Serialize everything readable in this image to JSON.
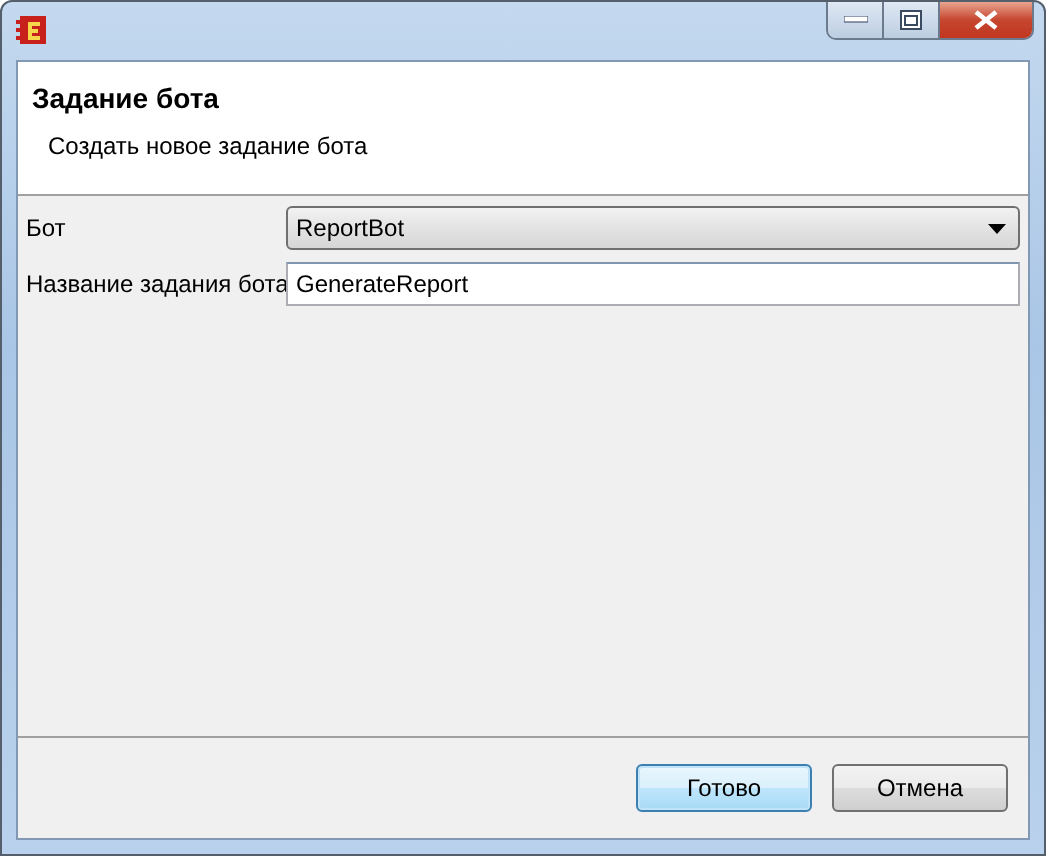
{
  "header": {
    "title": "Задание бота",
    "subtitle": "Создать новое задание бота"
  },
  "fields": [
    {
      "kind": "dropdown",
      "label": "Бот",
      "value": "ReportBot"
    },
    {
      "kind": "text",
      "label": "Название задания бота",
      "value": "GenerateReport"
    }
  ],
  "buttons": [
    {
      "label": "Готово",
      "default": true
    },
    {
      "label": "Отмена",
      "default": false
    }
  ]
}
